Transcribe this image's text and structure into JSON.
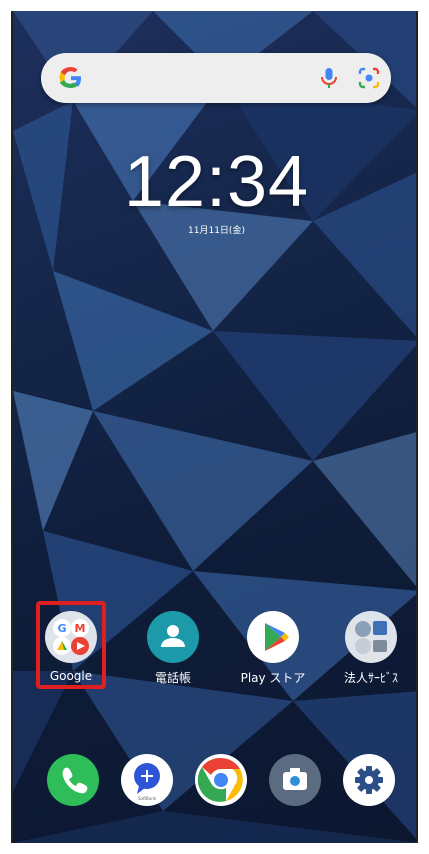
{
  "search": {
    "logo": "G",
    "icons": [
      "mic-icon",
      "lens-icon"
    ]
  },
  "clock": {
    "time": "12:34",
    "date": "11月11日(金)"
  },
  "apps": [
    {
      "label": "Google",
      "icon": "google-folder-icon"
    },
    {
      "label": "電話帳",
      "icon": "contacts-icon"
    },
    {
      "label": "Play ストア",
      "icon": "play-store-icon"
    },
    {
      "label": "法人ｻｰﾋﾞｽ",
      "icon": "business-services-folder-icon"
    }
  ],
  "dock": [
    {
      "icon": "phone-icon"
    },
    {
      "icon": "softbank-message-icon",
      "sublabel": "SoftBank"
    },
    {
      "icon": "chrome-icon"
    },
    {
      "icon": "camera-icon"
    },
    {
      "icon": "settings-gear-icon"
    }
  ],
  "colors": {
    "highlight": "#e02020",
    "phone": "#2ebd59",
    "contacts": "#1c9aaa",
    "settings_bg": "#ffffff"
  }
}
